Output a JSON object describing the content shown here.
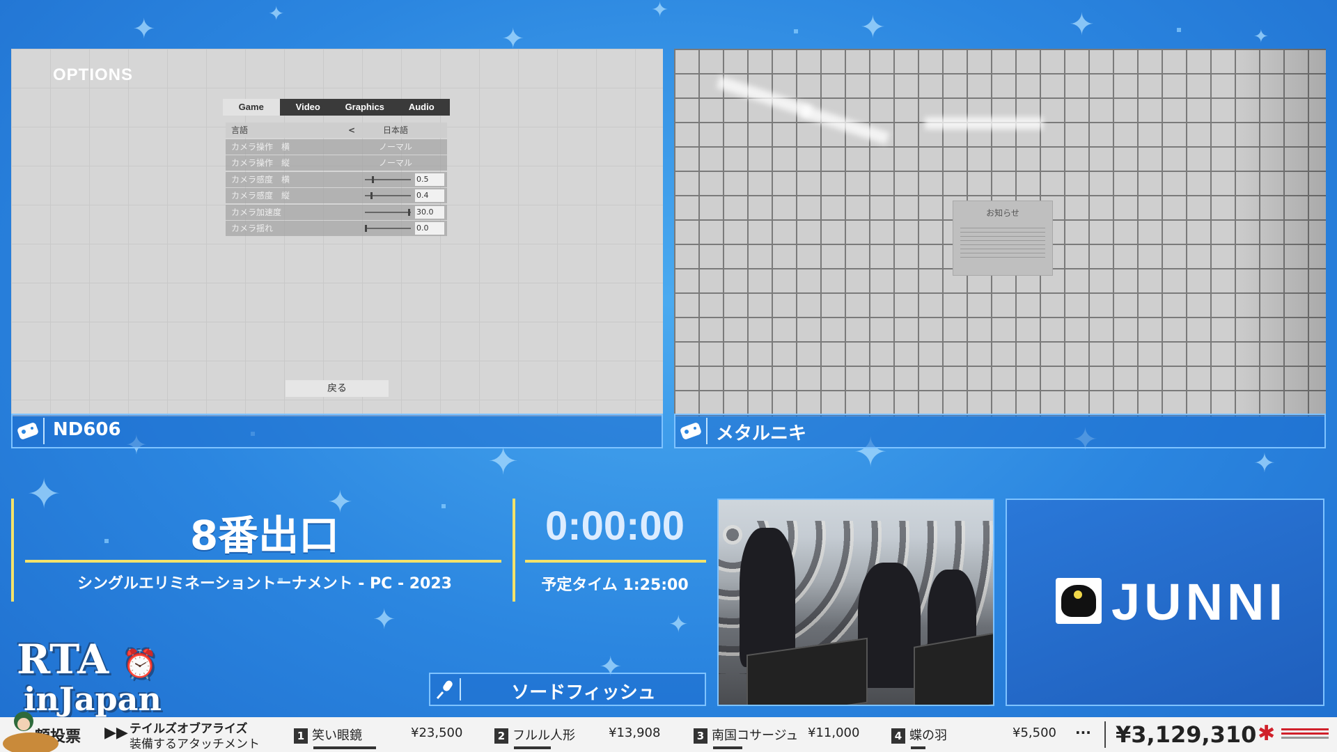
{
  "left_runner": {
    "name": "ND606",
    "options_screen": {
      "title": "OPTIONS",
      "tabs": [
        "Game",
        "Video",
        "Graphics",
        "Audio"
      ],
      "active_tab": "Game",
      "rows": [
        {
          "label": "言語",
          "value": "日本語"
        },
        {
          "label": "カメラ操作　横",
          "value": "ノーマル"
        },
        {
          "label": "カメラ操作　縦",
          "value": "ノーマル"
        },
        {
          "label": "カメラ感度　横",
          "value": "0.5"
        },
        {
          "label": "カメラ感度　縦",
          "value": "0.4"
        },
        {
          "label": "カメラ加速度",
          "value": "30.0"
        },
        {
          "label": "カメラ揺れ",
          "value": "0.0"
        }
      ],
      "back_label": "戻る"
    }
  },
  "right_runner": {
    "name": "メタルニキ",
    "notice_title": "お知らせ"
  },
  "run_info": {
    "game": "8番出口",
    "category": "シングルエリミネーショントーナメント - PC - 2023",
    "timer": "0:00:00",
    "estimate": "予定タイム 1:25:00"
  },
  "commentator": "ソードフィッシュ",
  "sponsor": "JUNNI",
  "event_logo": {
    "line1": "RTA",
    "line2": "in",
    "line3": "Japan"
  },
  "ticker": {
    "ballot_label": "額投票",
    "game": "テイルズオブアライズ",
    "item": "装備するアタッチメント",
    "entries": [
      {
        "rank": "1",
        "name": "笑い眼鏡",
        "amount": "¥23,500",
        "fill": 1.0
      },
      {
        "rank": "2",
        "name": "フルル人形",
        "amount": "¥13,908",
        "fill": 0.59
      },
      {
        "rank": "3",
        "name": "南国コサージュ",
        "amount": "¥11,000",
        "fill": 0.47
      },
      {
        "rank": "4",
        "name": "蝶の羽",
        "amount": "¥5,500",
        "fill": 0.23
      }
    ],
    "more": "···",
    "total": "¥3,129,310"
  },
  "colors": {
    "accent_yellow": "#f3e26a",
    "panel_border": "#7fc3ff",
    "msf_red": "#d0202a"
  }
}
